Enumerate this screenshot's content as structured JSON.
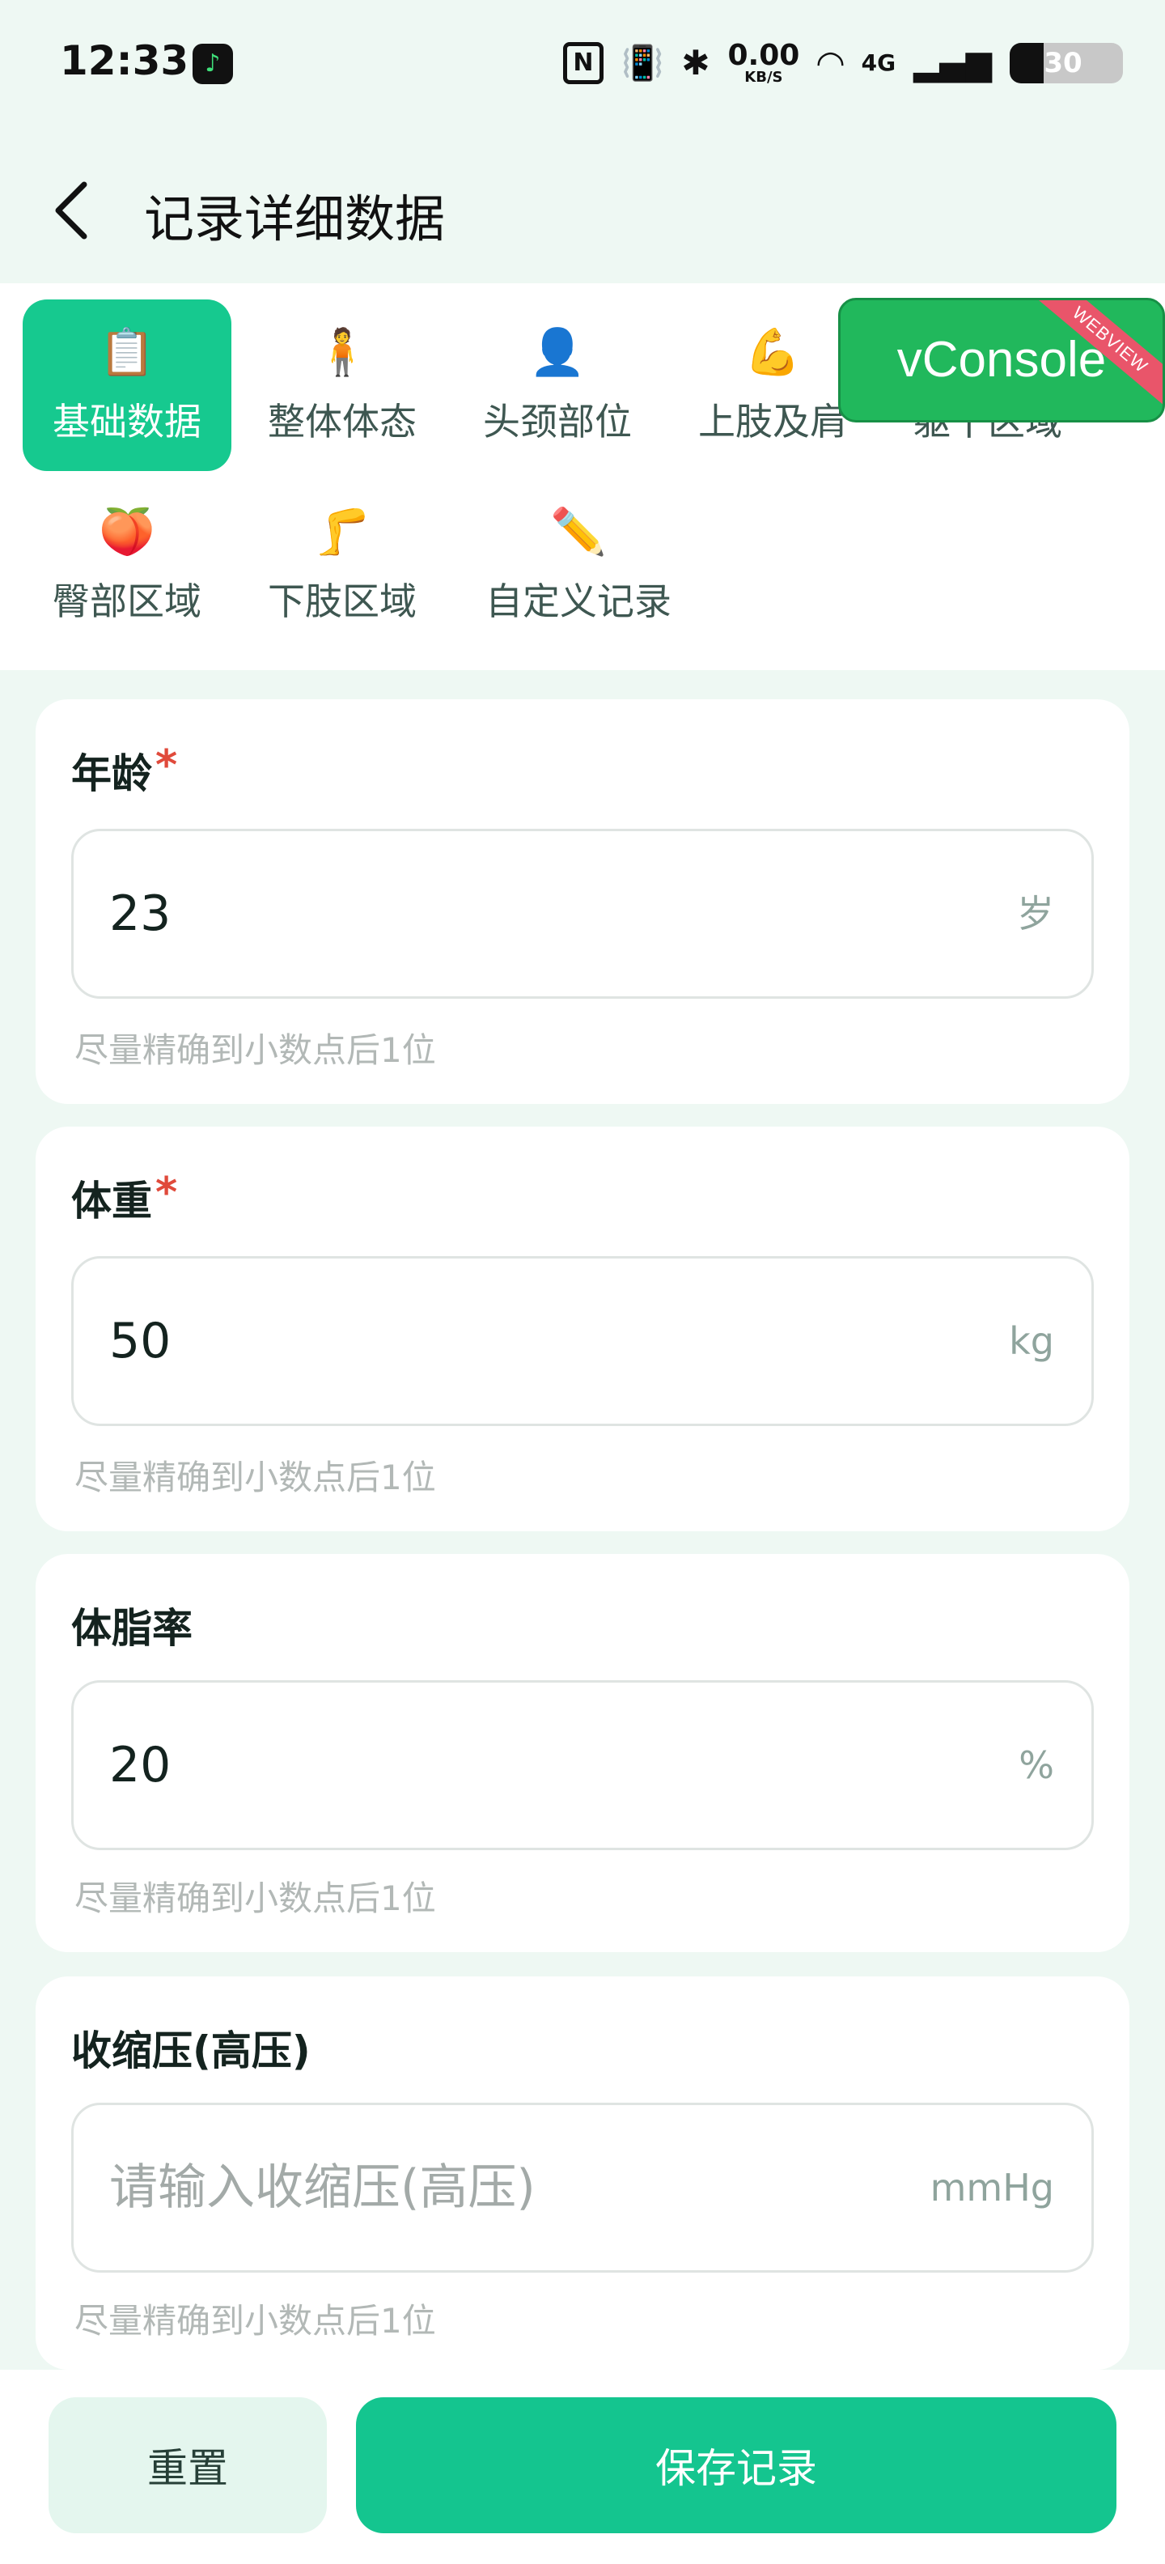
{
  "status_bar": {
    "time": "12:33",
    "app_badge": "♪",
    "nfc": "N",
    "vibrate": "📳",
    "bluetooth": "✱",
    "speed_value": "0.00",
    "speed_unit": "KB/S",
    "wifi": "◠",
    "network": "4G",
    "signal": "▂▄▆",
    "battery": "30",
    "battery_level_percent": 30
  },
  "header": {
    "title": "记录详细数据"
  },
  "tabs": [
    {
      "icon": "📋",
      "label": "基础数据",
      "active": true
    },
    {
      "icon": "🧍",
      "label": "整体体态",
      "active": false
    },
    {
      "icon": "👤",
      "label": "头颈部位",
      "active": false
    },
    {
      "icon": "💪",
      "label": "上肢及肩",
      "active": false
    },
    {
      "icon": "🧍",
      "label": "躯干区域",
      "active": false
    },
    {
      "icon": "🍑",
      "label": "臀部区域",
      "active": false
    },
    {
      "icon": "🦵",
      "label": "下肢区域",
      "active": false
    },
    {
      "icon": "✏️",
      "label": "自定义记录",
      "active": false
    }
  ],
  "vconsole": {
    "label": "vConsole",
    "ribbon": "WEBVIEW"
  },
  "fields": [
    {
      "label": "年龄",
      "required": "*",
      "value": "23",
      "placeholder": "",
      "unit": "岁",
      "hint": "尽量精确到小数点后1位"
    },
    {
      "label": "体重",
      "required": "*",
      "value": "50",
      "placeholder": "",
      "unit": "kg",
      "hint": "尽量精确到小数点后1位"
    },
    {
      "label": "体脂率",
      "required": "",
      "value": "20",
      "placeholder": "",
      "unit": "%",
      "hint": "尽量精确到小数点后1位"
    },
    {
      "label": "收缩压(高压)",
      "required": "",
      "value": "",
      "placeholder": "请输入收缩压(高压)",
      "unit": "mmHg",
      "hint": "尽量精确到小数点后1位"
    }
  ],
  "actions": {
    "reset_label": "重置",
    "save_label": "保存记录"
  },
  "colors": {
    "accent": "#16c98f",
    "required": "#e04a3b",
    "vconsole": "#21b85c"
  }
}
